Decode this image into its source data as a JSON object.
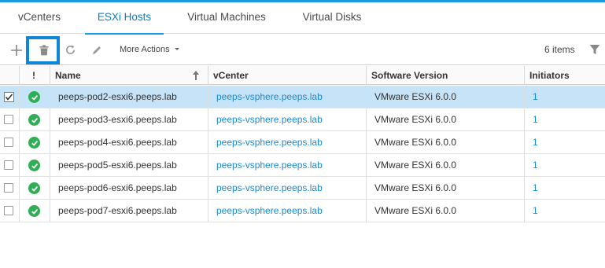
{
  "tabs": [
    {
      "label": "vCenters",
      "active": false
    },
    {
      "label": "ESXi Hosts",
      "active": true
    },
    {
      "label": "Virtual Machines",
      "active": false
    },
    {
      "label": "Virtual Disks",
      "active": false
    }
  ],
  "toolbar": {
    "icons": [
      "add-icon",
      "trash-icon",
      "refresh-icon",
      "pencil-icon",
      "filter-icon"
    ],
    "more_actions_label": "More Actions",
    "items_count": "6 items"
  },
  "table": {
    "columns": [
      "",
      "!",
      "Name",
      "vCenter",
      "Software Version",
      "Initiators"
    ],
    "rows": [
      {
        "selected": true,
        "status": "ok",
        "name": "peeps-pod2-esxi6.peeps.lab",
        "vcenter": "peeps-vsphere.peeps.lab",
        "version": "VMware ESXi 6.0.0",
        "initiators": "1"
      },
      {
        "selected": false,
        "status": "ok",
        "name": "peeps-pod3-esxi6.peeps.lab",
        "vcenter": "peeps-vsphere.peeps.lab",
        "version": "VMware ESXi 6.0.0",
        "initiators": "1"
      },
      {
        "selected": false,
        "status": "ok",
        "name": "peeps-pod4-esxi6.peeps.lab",
        "vcenter": "peeps-vsphere.peeps.lab",
        "version": "VMware ESXi 6.0.0",
        "initiators": "1"
      },
      {
        "selected": false,
        "status": "ok",
        "name": "peeps-pod5-esxi6.peeps.lab",
        "vcenter": "peeps-vsphere.peeps.lab",
        "version": "VMware ESXi 6.0.0",
        "initiators": "1"
      },
      {
        "selected": false,
        "status": "ok",
        "name": "peeps-pod6-esxi6.peeps.lab",
        "vcenter": "peeps-vsphere.peeps.lab",
        "version": "VMware ESXi 6.0.0",
        "initiators": "1"
      },
      {
        "selected": false,
        "status": "ok",
        "name": "peeps-pod7-esxi6.peeps.lab",
        "vcenter": "peeps-vsphere.peeps.lab",
        "version": "VMware ESXi 6.0.0",
        "initiators": "1"
      }
    ]
  },
  "colors": {
    "accent": "#1a9ae0",
    "link": "#1a8ad4",
    "selected_row": "#c7e3f7",
    "status_ok": "#2fae55",
    "highlight_box": "#0f86d8"
  }
}
